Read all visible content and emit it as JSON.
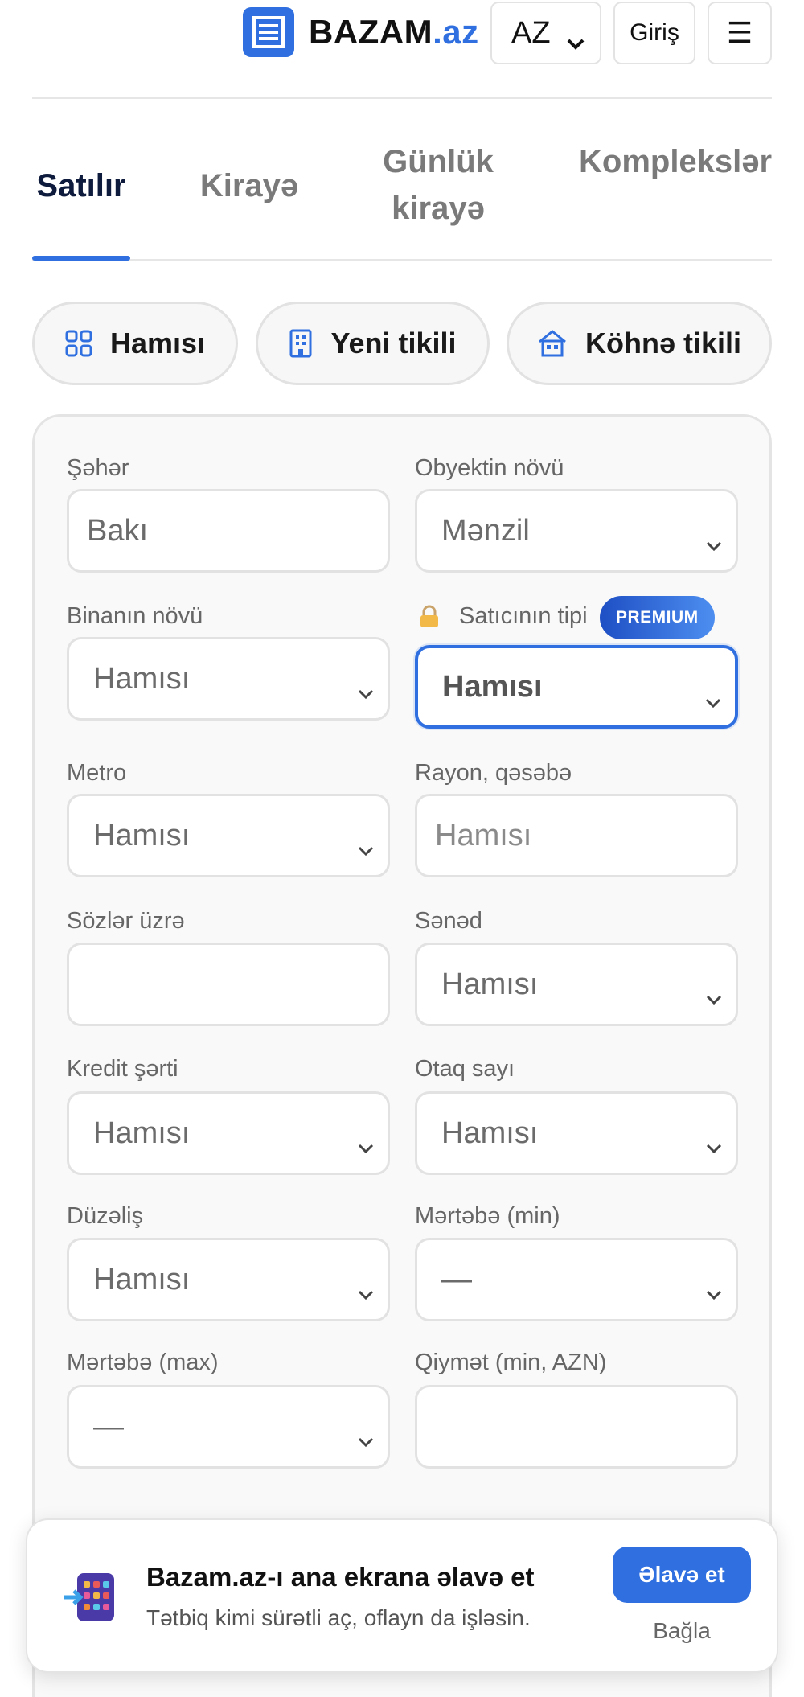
{
  "header": {
    "logo_name": "BAZAM",
    "logo_tld": ".az",
    "language": "AZ",
    "login_label": "Giriş",
    "menu_icon": "☰"
  },
  "tabs": [
    {
      "label": "Satılır",
      "active": true
    },
    {
      "label": "Kirayə",
      "active": false
    },
    {
      "label": "Günlük kirayə",
      "active": false
    },
    {
      "label": "Komplekslər",
      "active": false
    }
  ],
  "categories": [
    {
      "label": "Hamısı",
      "icon": "grid-icon"
    },
    {
      "label": "Yeni tikili",
      "icon": "building-icon"
    },
    {
      "label": "Köhnə tikili",
      "icon": "house-icon"
    }
  ],
  "filters": {
    "city": {
      "label": "Şəhər",
      "value": "Bakı"
    },
    "object_type": {
      "label": "Obyektin növü",
      "value": "Mənzil"
    },
    "building_type": {
      "label": "Binanın növü",
      "value": "Hamısı"
    },
    "seller_type": {
      "label": "Satıcının tipi",
      "value": "Hamısı",
      "badge": "PREMIUM"
    },
    "metro": {
      "label": "Metro",
      "value": "Hamısı"
    },
    "district": {
      "label": "Rayon, qəsəbə",
      "placeholder": "Hamısı"
    },
    "keywords": {
      "label": "Sözlər üzrə",
      "value": ""
    },
    "document": {
      "label": "Sənəd",
      "value": "Hamısı"
    },
    "credit": {
      "label": "Kredit şərti",
      "value": "Hamısı"
    },
    "rooms": {
      "label": "Otaq sayı",
      "value": "Hamısı"
    },
    "renovation": {
      "label": "Düzəliş",
      "value": "Hamısı"
    },
    "floor_min": {
      "label": "Mərtəbə (min)",
      "value": "—"
    },
    "floor_max": {
      "label": "Mərtəbə (max)",
      "value": "—"
    },
    "price_min": {
      "label": "Qiymət (min, AZN)",
      "value": ""
    }
  },
  "install_banner": {
    "title": "Bazam.az-ı ana ekrana əlavə et",
    "subtitle": "Tətbiq kimi sürətli aç, oflayn da işləsin.",
    "add_label": "Əlavə et",
    "close_label": "Bağla"
  },
  "colors": {
    "accent": "#2f6fe0",
    "title_dark": "#0f1b3d"
  }
}
